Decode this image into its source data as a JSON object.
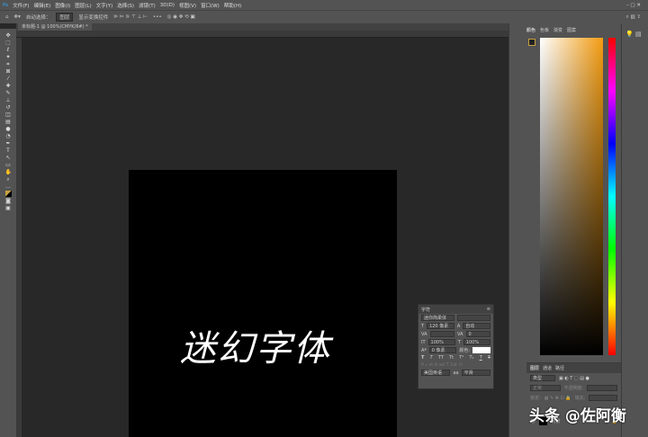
{
  "menu": [
    "文件(F)",
    "编辑(E)",
    "图像(I)",
    "图层(L)",
    "文字(Y)",
    "选择(S)",
    "滤镜(T)",
    "3D(D)",
    "视图(V)",
    "窗口(W)",
    "帮助(H)"
  ],
  "options": {
    "auto_select": "自动选择：",
    "target": "图层",
    "show_transform": "显示变换控件",
    "more": "•••"
  },
  "document_tab": "未标题-1 @ 100%(CMYK/8#) *",
  "canvas_text": "迷幻字体",
  "color_panel": {
    "tabs": [
      "颜色",
      "色板",
      "渐变",
      "图案"
    ]
  },
  "character_panel": {
    "title": "字符",
    "font": "迷你简柔体",
    "size": "120 像素",
    "leading": "自动",
    "tracking": "0",
    "vscale": "100%",
    "hscale": "100%",
    "baseline": "0 像素",
    "color_label": "颜色:",
    "language": "美国英语",
    "antialias": "平滑",
    "styles": [
      "T",
      "T",
      "TT",
      "Tt",
      "T¹",
      "T₁",
      "T",
      "T"
    ]
  },
  "layers_panel": {
    "tabs": [
      "图层",
      "通道",
      "路径"
    ],
    "filter": "类型",
    "blend": "正常",
    "opacity_label": "不透明度:",
    "lock_label": "锁定:",
    "fill_label": "填充:",
    "layer_name": "背景"
  },
  "watermark": "头条 @佐阿衡"
}
